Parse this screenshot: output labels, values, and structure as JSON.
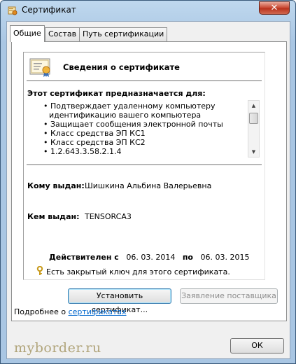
{
  "window": {
    "title": "Сертификат",
    "close_label": "✕"
  },
  "tabs": [
    {
      "label": "Общие"
    },
    {
      "label": "Состав"
    },
    {
      "label": "Путь сертификации"
    }
  ],
  "info": {
    "title": "Сведения о сертификате",
    "purpose_title": "Этот сертификат предназначается для:",
    "purposes": [
      "• Подтверждает удаленному компьютеру",
      "  идентификацию вашего компьютера",
      "• Защищает сообщения электронной почты",
      "• Класс средства ЭП КС1",
      "• Класс средства ЭП КС2",
      "• 1.2.643.3.58.2.1.4"
    ],
    "issued_to_label": "Кому выдан:",
    "issued_to_value": "Шишкина Альбина Валерьевна",
    "issued_by_label": "Кем выдан:",
    "issued_by_value": "TENSORCA3",
    "valid_from_label": "Действителен с",
    "valid_from_value": "06. 03. 2014",
    "valid_to_label": "по",
    "valid_to_value": "06. 03. 2015",
    "private_key_text": "Есть закрытый ключ для этого сертификата."
  },
  "buttons": {
    "install": "Установить сертификат...",
    "issuer_statement": "Заявление поставщика",
    "ok": "ОК"
  },
  "more": {
    "prefix": "Подробнее о",
    "link": "сертификатах"
  },
  "watermark": "myborder.ru"
}
